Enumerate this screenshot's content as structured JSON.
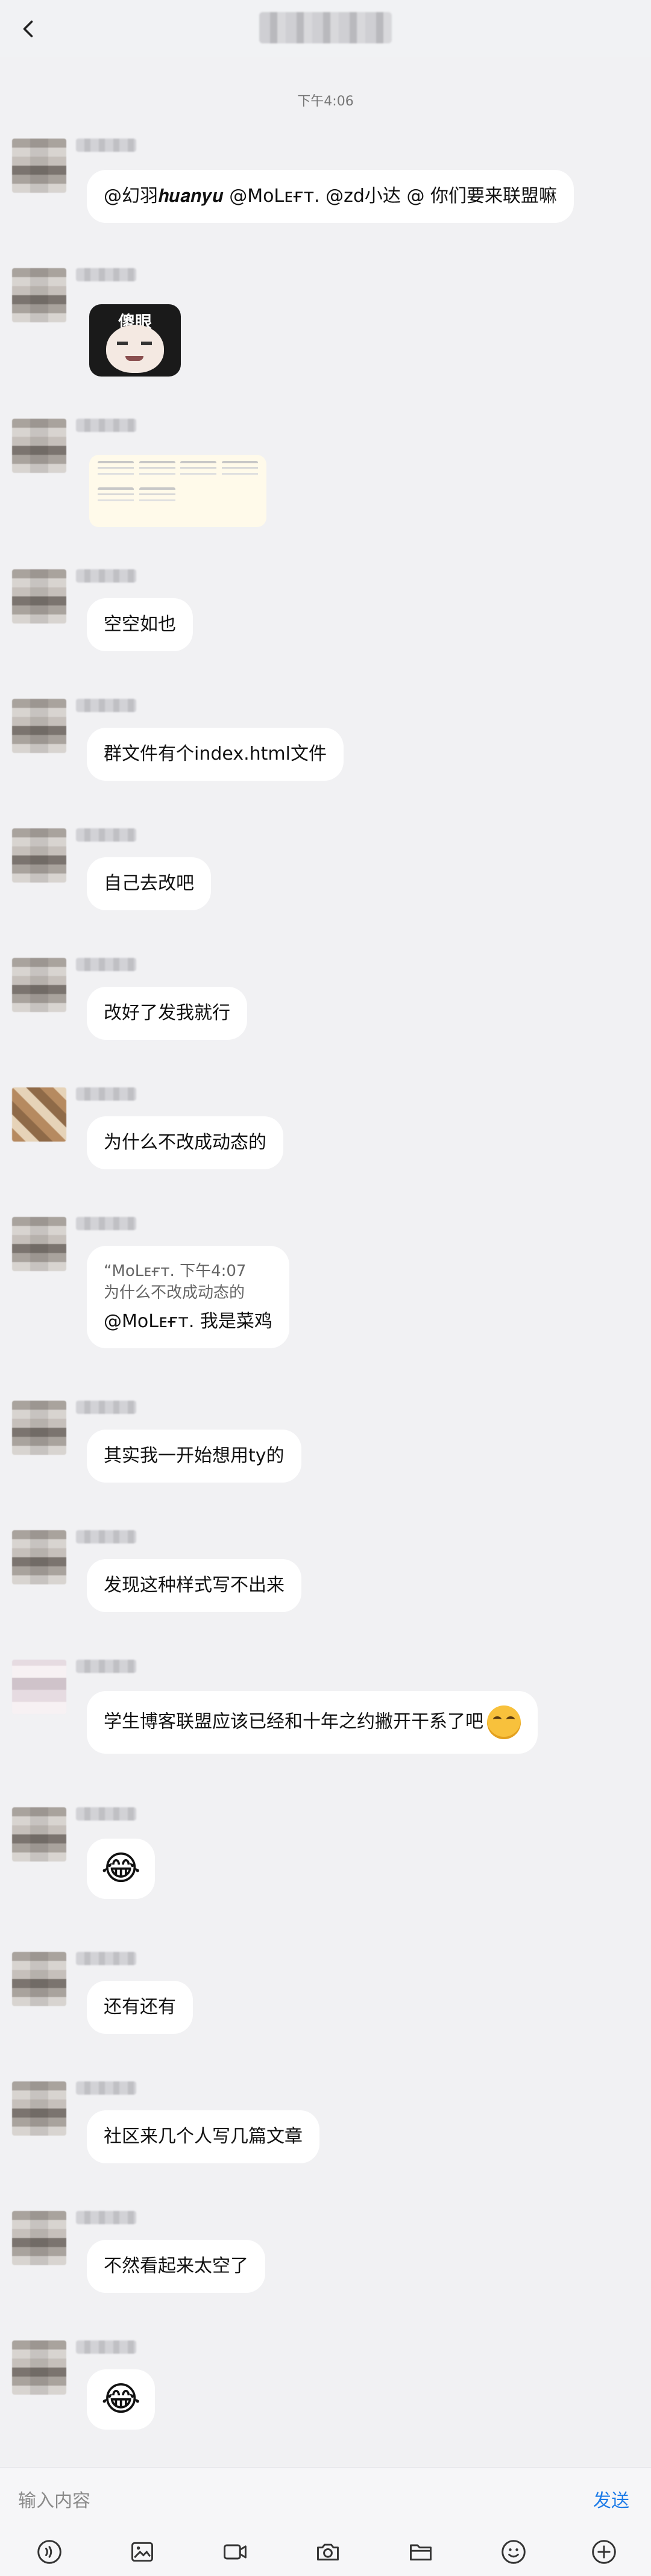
{
  "header": {
    "back_label": "‹",
    "title": ""
  },
  "timestamp": "下午4:06",
  "messages": [
    {
      "text": "@幻羽𝒉𝒖𝒂𝒏𝒚𝒖 @MᴏLᴇғᴛ. @zd小达 @ 你们要来联盟嘛"
    },
    {
      "sticker_caption": "傻眼"
    },
    {
      "card_label": "shared-card"
    },
    {
      "text": "空空如也"
    },
    {
      "text": "群文件有个index.html文件"
    },
    {
      "text": "自己去改吧"
    },
    {
      "text": "改好了发我就行"
    },
    {
      "text": "为什么不改成动态的"
    },
    {
      "quote_author": "“MᴏLᴇғᴛ. 下午4:07",
      "quote_text": "为什么不改成动态的",
      "text": "@MᴏLᴇғᴛ. 我是菜鸡"
    },
    {
      "text": "其实我一开始想用ty的"
    },
    {
      "text": "发现这种样式写不出来"
    },
    {
      "text": "学生博客联盟应该已经和十年之约撇开干系了吧"
    },
    {
      "emoji": "😂"
    },
    {
      "text": "还有还有"
    },
    {
      "text": "社区来几个人写几篇文章"
    },
    {
      "text": "不然看起来太空了"
    },
    {
      "emoji": "😂"
    }
  ],
  "input": {
    "placeholder": "输入内容",
    "send_label": "发送"
  },
  "toolbar": {
    "icons": [
      "voice-icon",
      "image-icon",
      "video-icon",
      "camera-icon",
      "folder-icon",
      "emoji-icon",
      "plus-icon"
    ]
  }
}
